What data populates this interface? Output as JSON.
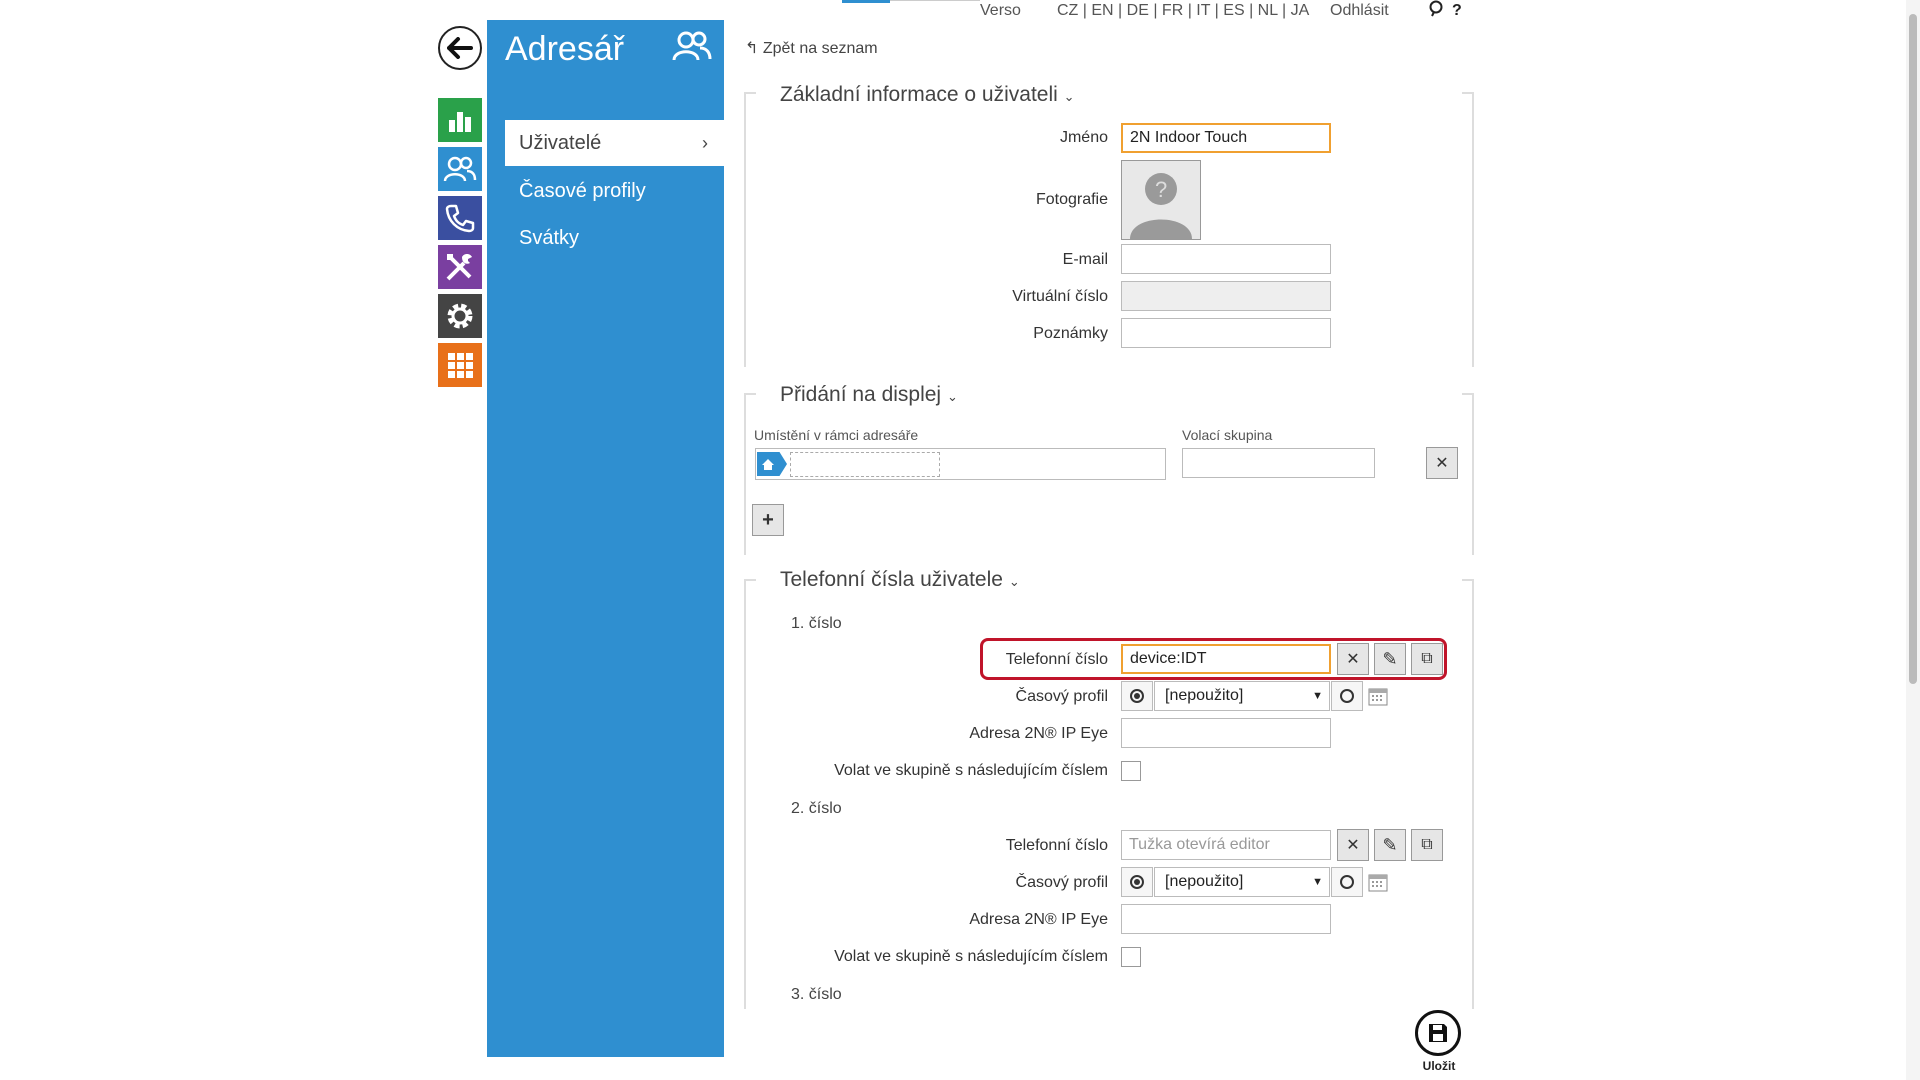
{
  "topbar": {
    "product": "Verso",
    "languages": "CZ | EN | DE | FR | IT | ES | NL | JA",
    "logout": "Odhlásit",
    "help": "?"
  },
  "sidebar": {
    "title": "Adresář",
    "items": [
      {
        "label": "Uživatelé",
        "active": true
      },
      {
        "label": "Časové profily"
      },
      {
        "label": "Svátky"
      }
    ]
  },
  "rail": {
    "colors": [
      "#2aa14a",
      "#2f8fd0",
      "#3a4fa0",
      "#7a3fa0",
      "#444444",
      "#e8701a"
    ]
  },
  "main": {
    "back_link": "Zpět na seznam",
    "basic": {
      "title": "Základní informace o uživateli",
      "name_label": "Jméno",
      "name_value": "2N Indoor Touch",
      "photo_label": "Fotografie",
      "email_label": "E-mail",
      "email_value": "",
      "virtual_label": "Virtuální číslo",
      "notes_label": "Poznámky",
      "notes_value": ""
    },
    "display": {
      "title": "Přidání na displej",
      "location_label": "Umístění v rámci adresáře",
      "group_label": "Volací skupina"
    },
    "phones": {
      "title": "Telefonní čísla uživatele",
      "entries": [
        {
          "heading": "1. číslo",
          "phone_label": "Telefonní číslo",
          "phone_value": "device:IDT",
          "phone_placeholder": "",
          "profile_label": "Časový profil",
          "profile_value": "[nepoužito]",
          "ipeye_label": "Adresa 2N® IP Eye",
          "group_call_label": "Volat ve skupině s následujícím číslem"
        },
        {
          "heading": "2. číslo",
          "phone_label": "Telefonní číslo",
          "phone_value": "",
          "phone_placeholder": "Tužka otevírá editor",
          "profile_label": "Časový profil",
          "profile_value": "[nepoužito]",
          "ipeye_label": "Adresa 2N® IP Eye",
          "group_call_label": "Volat ve skupině s následujícím číslem"
        }
      ],
      "third_heading": "3. číslo"
    },
    "save_label": "Uložit"
  }
}
